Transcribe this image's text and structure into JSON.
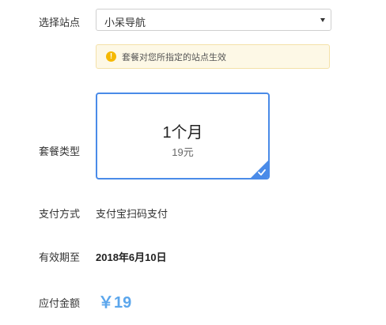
{
  "site": {
    "label": "选择站点",
    "selected": "小呆导航"
  },
  "notice": {
    "icon": "warning-icon",
    "text": "套餐对您所指定的站点生效"
  },
  "plan": {
    "label": "套餐类型",
    "title": "1个月",
    "price": "19元",
    "selected": true,
    "accent": "#4a8be8"
  },
  "payment": {
    "label": "支付方式",
    "value": "支付宝扫码支付"
  },
  "expiry": {
    "label": "有效期至",
    "value": "2018年6月10日"
  },
  "amount": {
    "label": "应付金额",
    "value": "￥19",
    "color": "#5ba6ec"
  }
}
